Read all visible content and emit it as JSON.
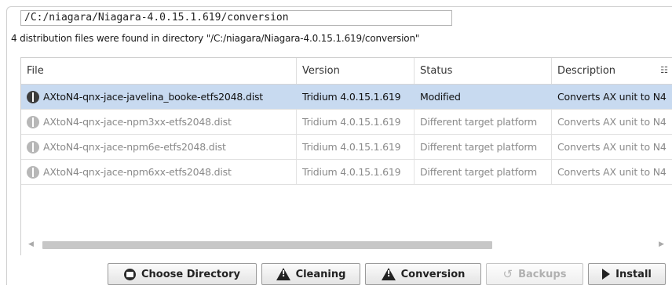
{
  "path_field": {
    "value": "/C:/niagara/Niagara-4.0.15.1.619/conversion"
  },
  "info_text": "4 distribution files were found in directory \"/C:/niagara/Niagara-4.0.15.1.619/conversion\"",
  "table": {
    "headers": [
      "File",
      "Version",
      "Status",
      "Description"
    ],
    "column_menu_icon": "table-options-icon",
    "rows": [
      {
        "file": "AXtoN4-qnx-jace-javelina_booke-etfs2048.dist",
        "version": "Tridium 4.0.15.1.619",
        "status": "Modified",
        "description": "Converts AX unit to N4",
        "selected": true
      },
      {
        "file": "AXtoN4-qnx-jace-npm3xx-etfs2048.dist",
        "version": "Tridium 4.0.15.1.619",
        "status": "Different target platform",
        "description": "Converts AX unit to N4",
        "selected": false
      },
      {
        "file": "AXtoN4-qnx-jace-npm6e-etfs2048.dist",
        "version": "Tridium 4.0.15.1.619",
        "status": "Different target platform",
        "description": "Converts AX unit to N4",
        "selected": false
      },
      {
        "file": "AXtoN4-qnx-jace-npm6xx-etfs2048.dist",
        "version": "Tridium 4.0.15.1.619",
        "status": "Different target platform",
        "description": "Converts AX unit to N4",
        "selected": false
      }
    ]
  },
  "buttons": {
    "choose_directory": "Choose Directory",
    "cleaning": "Cleaning",
    "conversion": "Conversion",
    "backups": "Backups",
    "install": "Install"
  },
  "colors": {
    "selected_row": "#c8daf0",
    "disabled_text": "#b0b0b0"
  }
}
